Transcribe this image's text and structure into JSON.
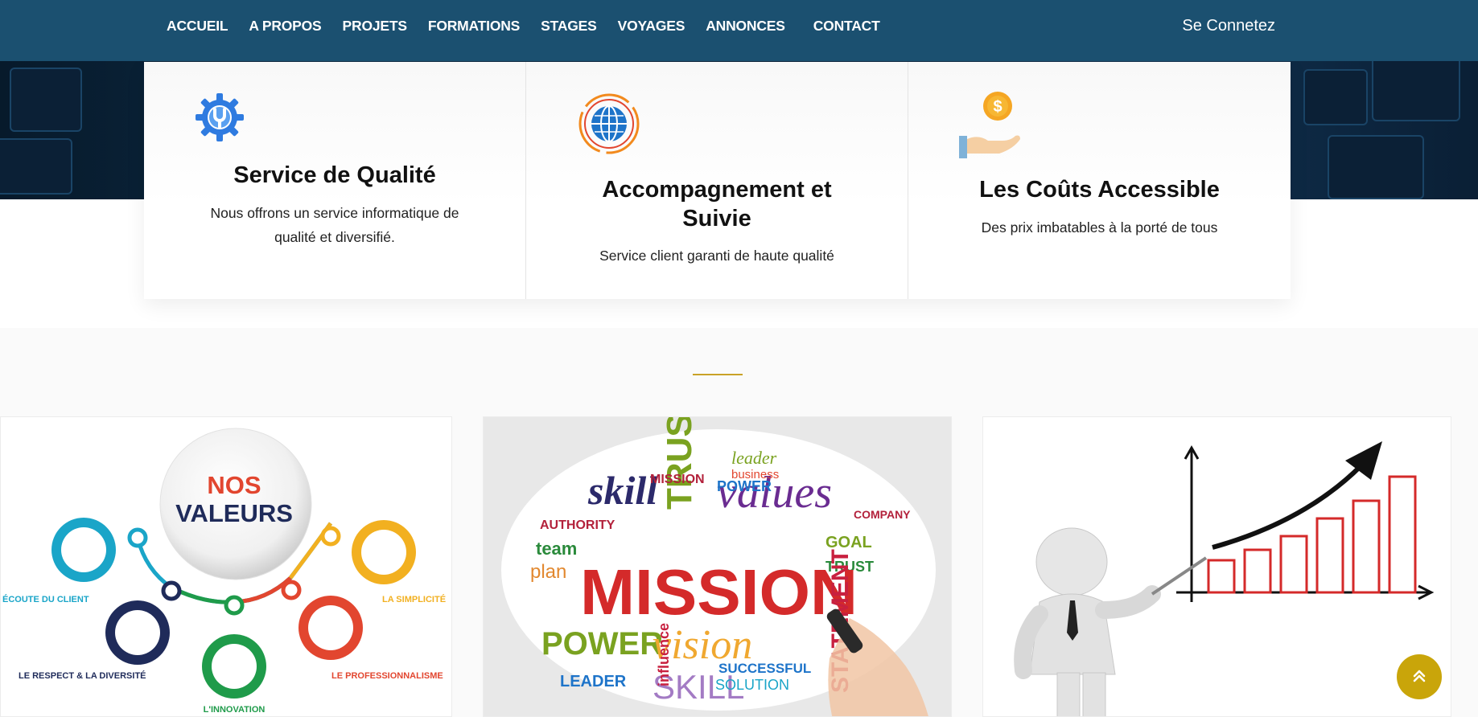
{
  "nav": {
    "items": [
      {
        "label": "ACCUEIL"
      },
      {
        "label": "A PROPOS"
      },
      {
        "label": "PROJETS"
      },
      {
        "label": "FORMATIONS"
      },
      {
        "label": "STAGES"
      },
      {
        "label": "VOYAGES"
      },
      {
        "label": "ANNONCES"
      },
      {
        "label": "CONTACT"
      }
    ],
    "login": "Se Connetez"
  },
  "features": [
    {
      "icon": "gear-wrench-icon",
      "title": "Service de Qualité",
      "text_line1": "Nous offrons un service informatique de",
      "text_line2": "qualité et diversifié."
    },
    {
      "icon": "globe-icon",
      "title_line1": "Accompagnement et",
      "title_line2": "Suivie",
      "text": "Service client garanti de haute qualité"
    },
    {
      "icon": "coin-hand-icon",
      "title": "Les Coûts Accessible",
      "text": "Des prix imbatables à la porté de tous"
    }
  ],
  "values_image": {
    "title_line1": "NOS",
    "title_line2": "VALEURS",
    "items": [
      "ÉCOUTE DU CLIENT",
      "LE RESPECT & LA DIVERSITÉ",
      "L'INNOVATION",
      "LE PROFESSIONNALISME",
      "LA SIMPLICITÉ"
    ]
  },
  "mission_image": {
    "main_word": "MISSION",
    "words": [
      "POWER",
      "vision",
      "values",
      "skill",
      "TRUST",
      "SKILL",
      "plan",
      "SOLUTION",
      "SUCCESSFUL",
      "LEADER",
      "GOAL",
      "TRUST",
      "team",
      "AUTHORITY",
      "STATEMENT",
      "leader",
      "business",
      "POWER",
      "COMPANY",
      "influence",
      "MISSION"
    ]
  },
  "colors": {
    "nav_bg": "#1b5070",
    "accent_gold": "#c9a50a"
  },
  "scroll_top_icon": "double-chevron-up-icon"
}
